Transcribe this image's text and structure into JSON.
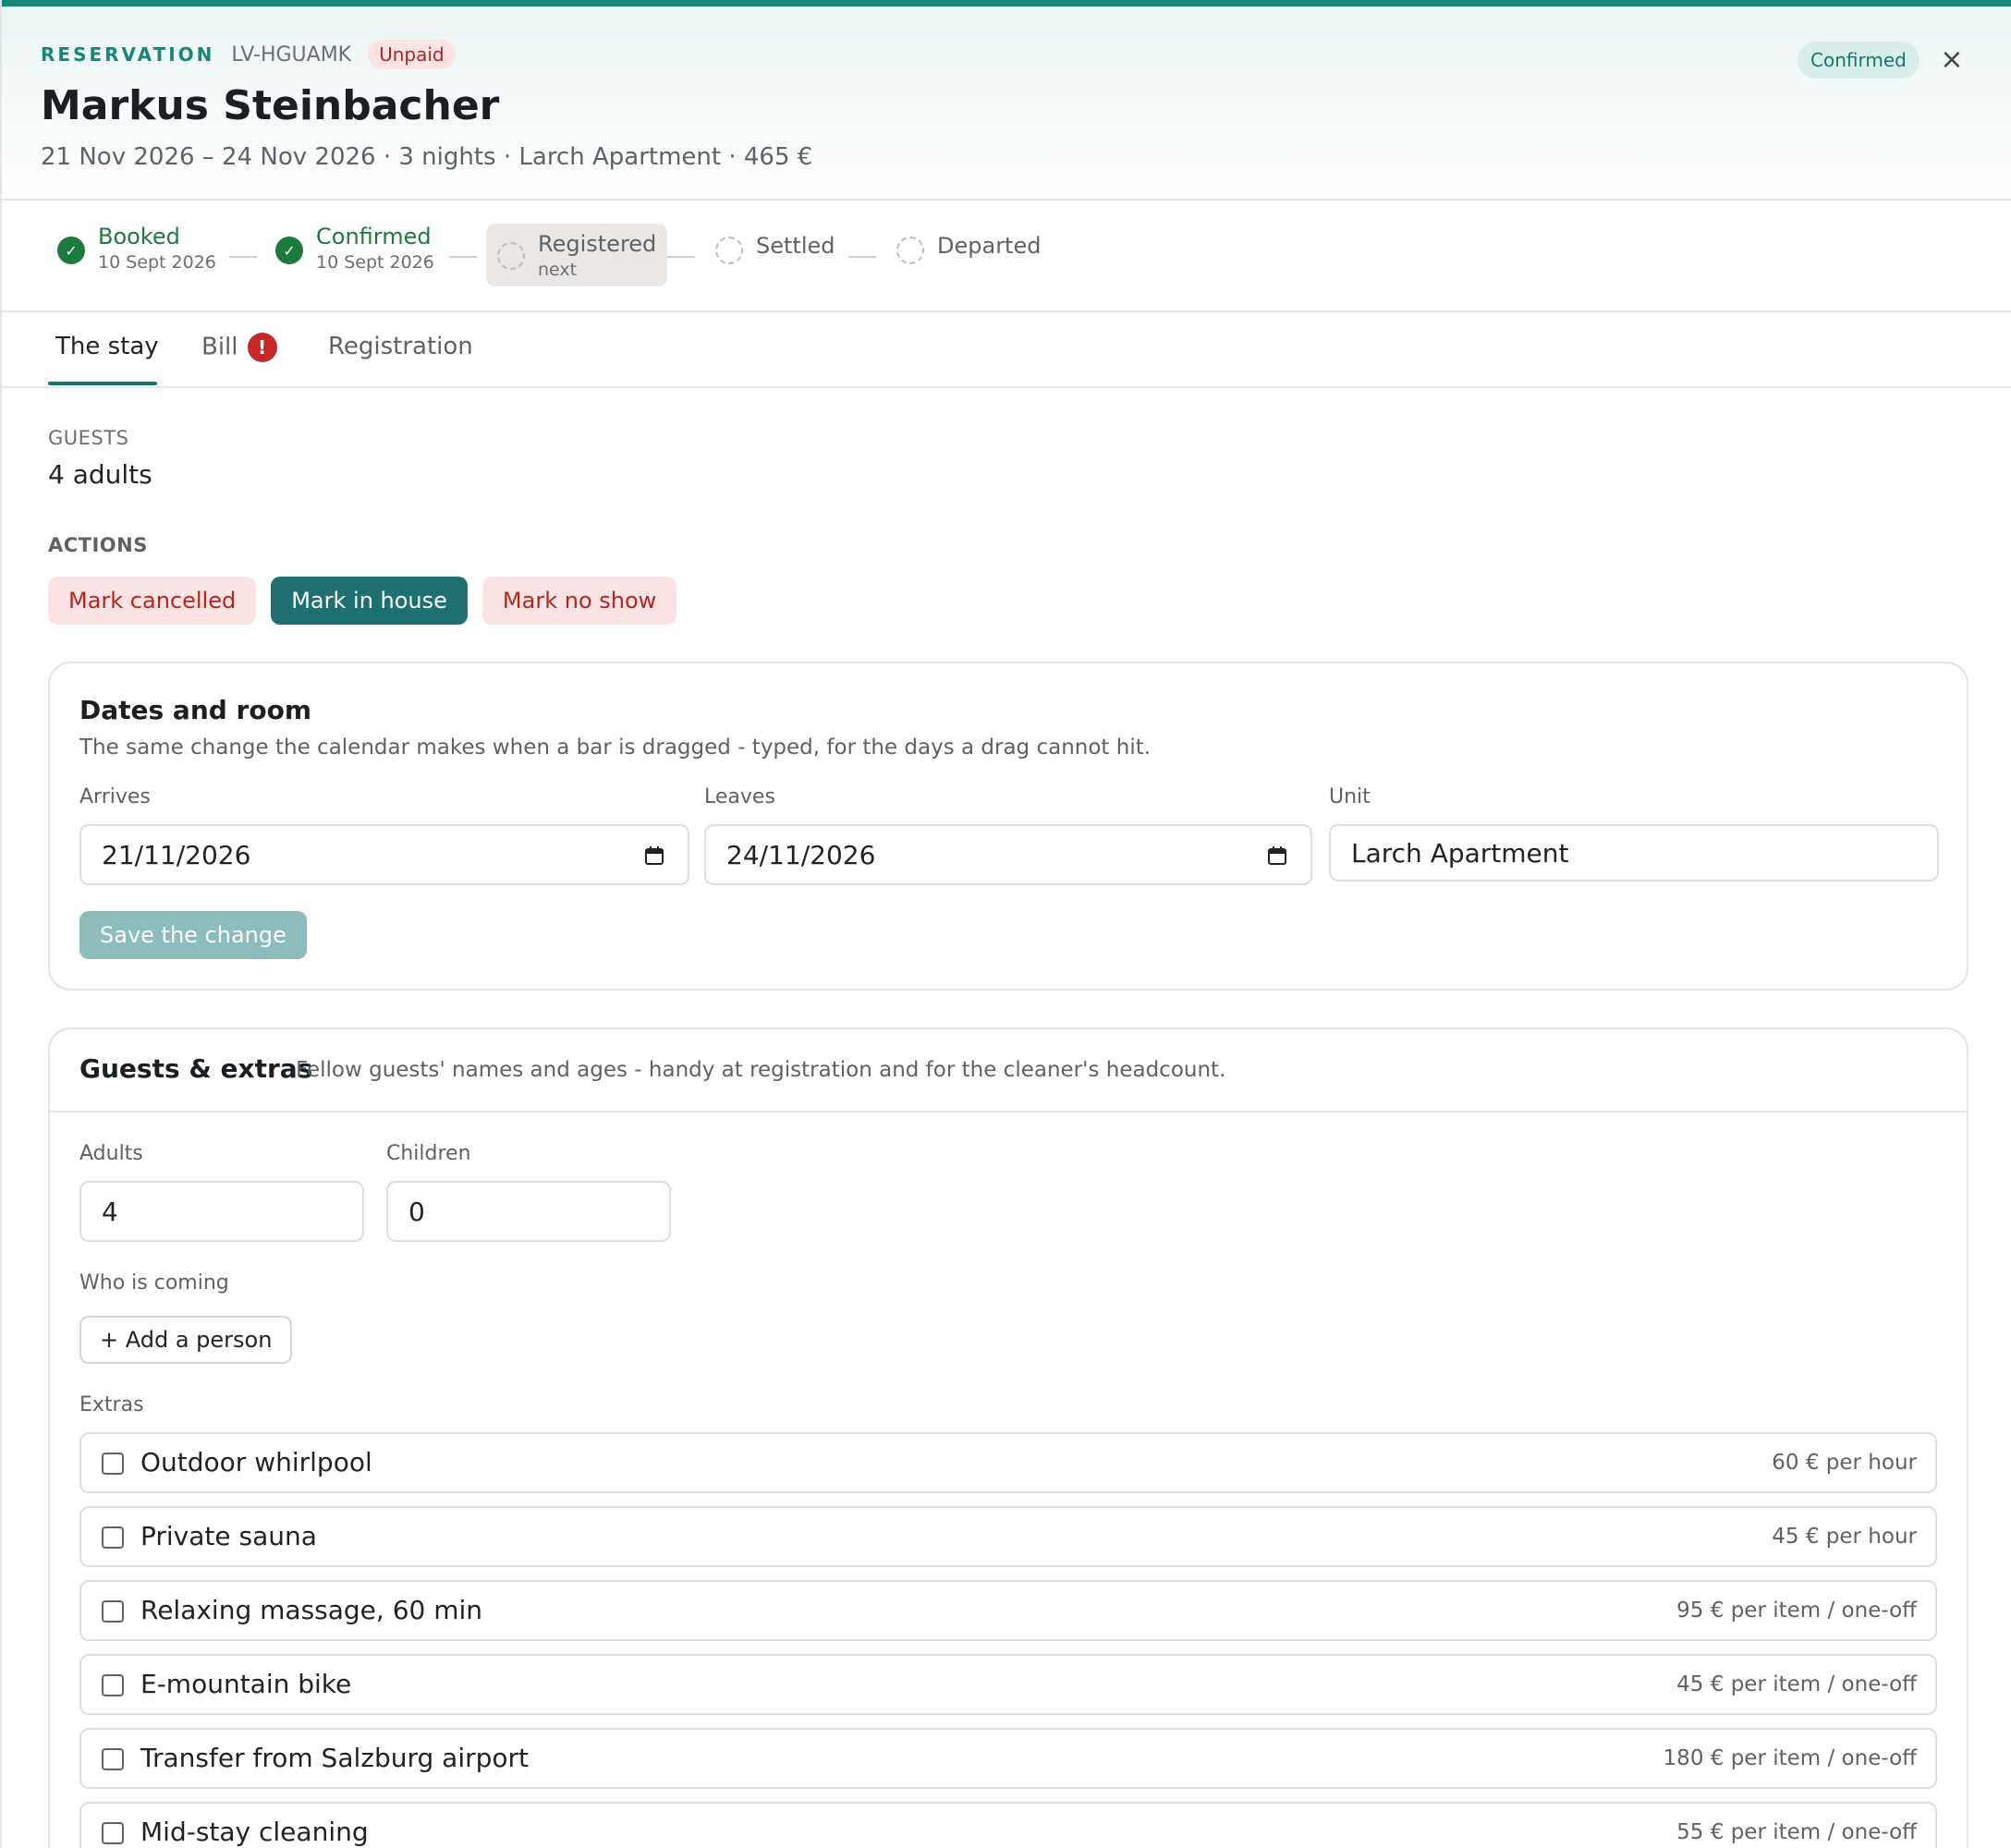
{
  "header": {
    "eyebrow": "RESERVATION",
    "code": "LV-HGUAMK",
    "payment_badge": "Unpaid",
    "guest_name": "Markus Steinbacher",
    "summary": "21 Nov 2026 – 24 Nov 2026 · 3 nights · Larch Apartment · 465 €",
    "status": "Confirmed",
    "close_glyph": "×"
  },
  "stepper": {
    "steps": [
      {
        "label": "Booked",
        "sub": "10 Sept 2026",
        "state": "done"
      },
      {
        "label": "Confirmed",
        "sub": "10 Sept 2026",
        "state": "done"
      },
      {
        "label": "Registered",
        "sub": "next",
        "state": "next"
      },
      {
        "label": "Settled",
        "sub": "",
        "state": "todo"
      },
      {
        "label": "Departed",
        "sub": "",
        "state": "todo"
      }
    ],
    "check_glyph": "✓"
  },
  "tabs": {
    "items": [
      {
        "label": "The stay",
        "active": true
      },
      {
        "label": "Bill",
        "alert": "!"
      },
      {
        "label": "Registration"
      }
    ]
  },
  "guests": {
    "label": "GUESTS",
    "value": "4 adults"
  },
  "actions": {
    "label": "ACTIONS",
    "cancel": "Mark cancelled",
    "in_house": "Mark in house",
    "no_show": "Mark no show"
  },
  "dates_room": {
    "title": "Dates and room",
    "description": "The same change the calendar makes when a bar is dragged - typed, for the days a drag cannot hit.",
    "arrives_label": "Arrives",
    "arrives_value": "21/11/2026",
    "leaves_label": "Leaves",
    "leaves_value": "24/11/2026",
    "unit_label": "Unit",
    "unit_value": "Larch Apartment",
    "save": "Save the change"
  },
  "guests_extras": {
    "title": "Guests & extras",
    "description": "Fellow guests' names and ages - handy at registration and for the cleaner's headcount.",
    "adults_label": "Adults",
    "adults_value": "4",
    "children_label": "Children",
    "children_value": "0",
    "who_label": "Who is coming",
    "add_person": "+ Add a person",
    "extras_label": "Extras",
    "extras": [
      {
        "name": "Outdoor whirlpool",
        "price": "60 € per hour"
      },
      {
        "name": "Private sauna",
        "price": "45 € per hour"
      },
      {
        "name": "Relaxing massage, 60 min",
        "price": "95 € per item / one-off"
      },
      {
        "name": "E-mountain bike",
        "price": "45 € per item / one-off"
      },
      {
        "name": "Transfer from Salzburg airport",
        "price": "180 € per item / one-off"
      },
      {
        "name": "Mid-stay cleaning",
        "price": "55 € per item / one-off"
      }
    ]
  },
  "colors": {
    "accent": "#17877a",
    "primary_button": "#1e6f6f",
    "danger_text": "#b3261e",
    "done_green": "#1c7a3d"
  }
}
